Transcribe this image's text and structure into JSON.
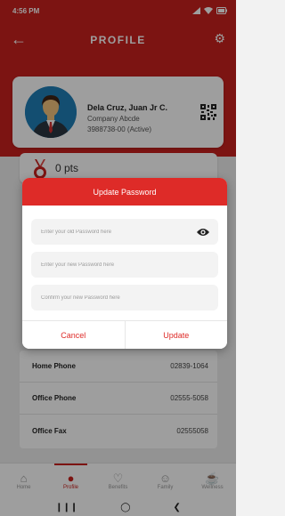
{
  "status_bar": {
    "time": "4:56 PM",
    "icons": [
      "signal-icon",
      "wifi-icon",
      "battery-icon"
    ]
  },
  "appbar": {
    "title": "PROFILE"
  },
  "profile": {
    "name": "Dela Cruz, Juan Jr C.",
    "company": "Company Abcde",
    "account": "3988738-00 (Active)"
  },
  "points": {
    "value": "0 pts"
  },
  "contact_rows": [
    {
      "label": "Home Phone",
      "value": "02839-1064"
    },
    {
      "label": "Office Phone",
      "value": "02555-5058"
    },
    {
      "label": "Office Fax",
      "value": "02555058"
    }
  ],
  "nav": [
    {
      "label": "Home",
      "icon": "home-icon",
      "active": false
    },
    {
      "label": "Profile",
      "icon": "person-icon",
      "active": true
    },
    {
      "label": "Benefits",
      "icon": "benefits-icon",
      "active": false
    },
    {
      "label": "Family",
      "icon": "family-icon",
      "active": false
    },
    {
      "label": "Wellness",
      "icon": "wellness-icon",
      "active": false
    }
  ],
  "dialog": {
    "title": "Update Password",
    "old_placeholder": "Enter your old Password here",
    "new_placeholder": "Enter your new Password here",
    "confirm_placeholder": "Confirm your new Password here",
    "cancel_label": "Cancel",
    "update_label": "Update"
  },
  "colors": {
    "brand_red": "#c9211e",
    "dialog_red": "#de2b28"
  }
}
